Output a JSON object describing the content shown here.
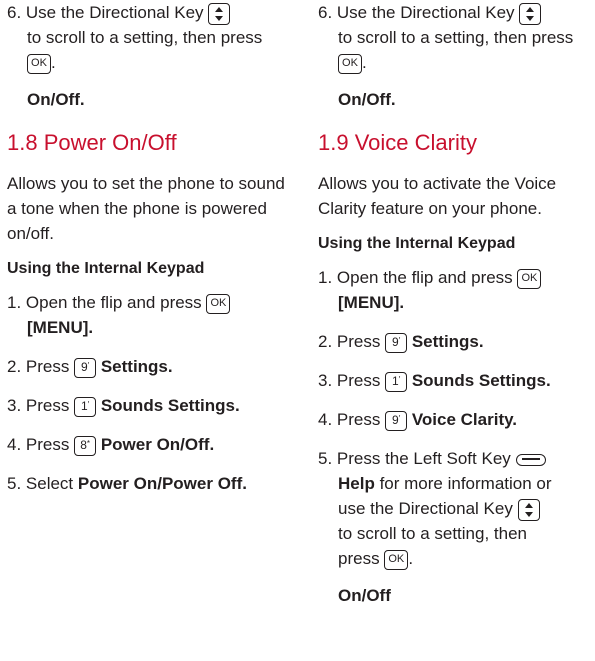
{
  "left": {
    "top_step": {
      "prefix": "6. Use the Directional Key",
      "line2": "to scroll to a setting, then press",
      "dir_key": "directional-key",
      "ok_key": "OK",
      "end": "."
    },
    "top_value": "On/Off.",
    "section_heading": "1.8 Power On/Off",
    "intro": "Allows you to set the phone to sound a tone when the phone is powered on/off.",
    "subhead": "Using the Internal Keypad",
    "steps": {
      "s1_prefix": "1. Open the flip and press",
      "s1_ok": "OK",
      "s1_menu": "[MENU].",
      "s2_prefix": "2. Press",
      "s2_key": "9",
      "s2_label": "Settings.",
      "s3_prefix": "3. Press",
      "s3_key": "1",
      "s3_label": "Sounds Settings.",
      "s4_prefix": "4. Press",
      "s4_key": "8",
      "s4_label": "Power On/Off.",
      "s5_prefix": "5. Select",
      "s5_label": "Power On/Power Off."
    }
  },
  "right": {
    "top_step": {
      "prefix": "6. Use the Directional Key",
      "line2": "to scroll to a setting, then press",
      "ok_key": "OK",
      "end": "."
    },
    "top_value": "On/Off.",
    "section_heading": "1.9 Voice Clarity",
    "intro": "Allows you to activate the Voice Clarity feature on your phone.",
    "subhead": "Using the Internal Keypad",
    "steps": {
      "s1_prefix": "1. Open the flip and press",
      "s1_ok": "OK",
      "s1_menu": "[MENU].",
      "s2_prefix": "2. Press",
      "s2_key": "9",
      "s2_label": "Settings.",
      "s3_prefix": "3. Press",
      "s3_key": "1",
      "s3_label": "Sounds Settings.",
      "s4_prefix": "4. Press",
      "s4_key": "9",
      "s4_label": "Voice Clarity.",
      "s5_prefix": "5. Press the Left Soft Key",
      "s5_help": "Help",
      "s5_rest1": "for more information or",
      "s5_rest2": "use the Directional Key",
      "s5_rest3": "to scroll to a setting, then",
      "s5_rest4": "press",
      "s5_ok": "OK",
      "s5_end": "."
    },
    "bottom_value": "On/Off"
  },
  "colors": {
    "heading": "#c8102e",
    "text": "#231f20"
  }
}
